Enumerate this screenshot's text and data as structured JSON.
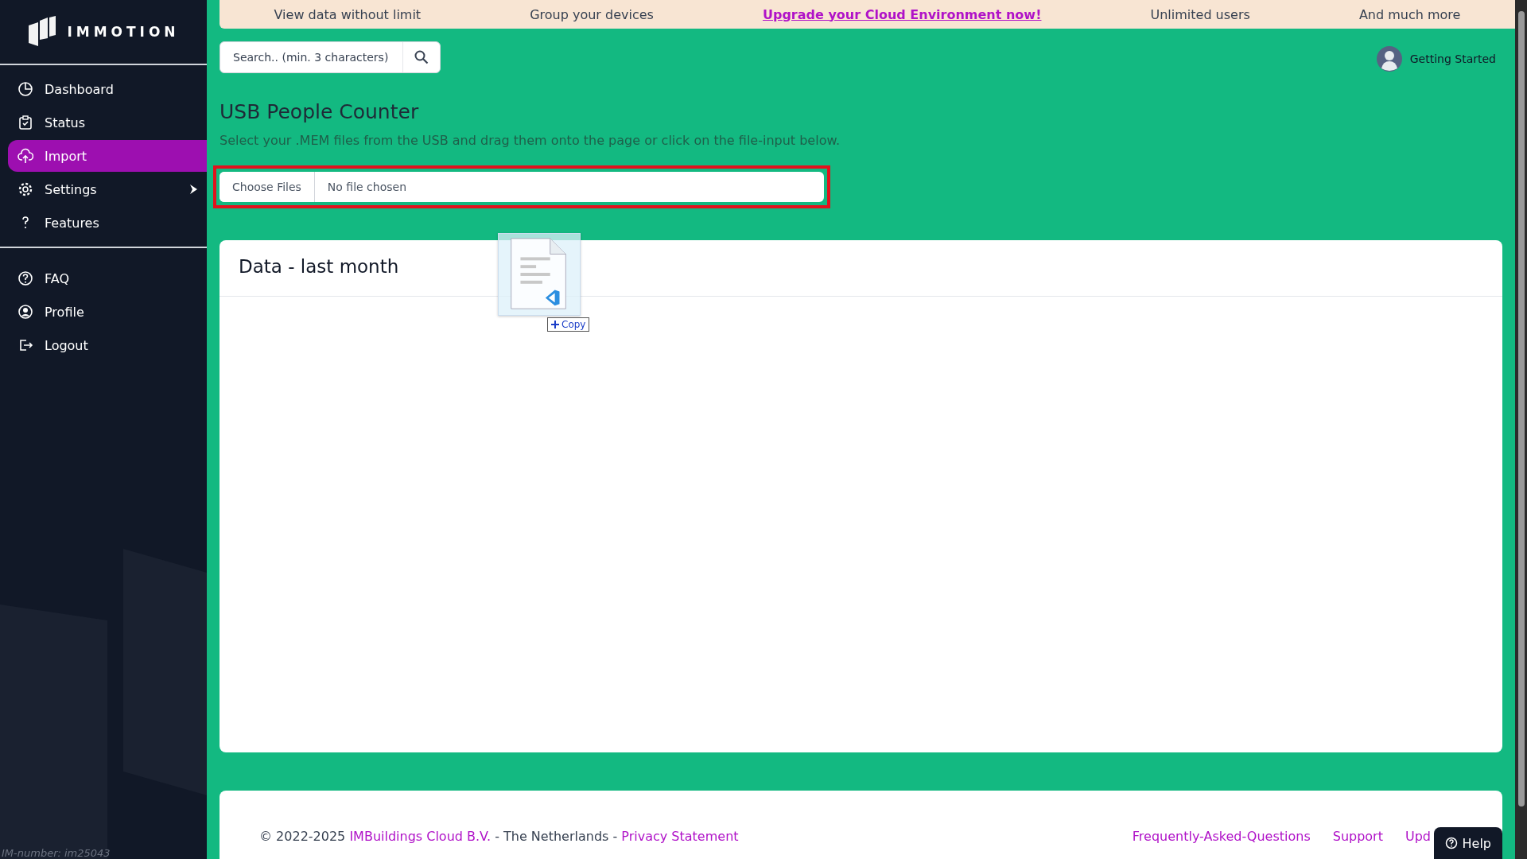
{
  "sidebar": {
    "logo": "IMMOTION",
    "items": [
      {
        "label": "Dashboard",
        "selected": false,
        "submenu": false
      },
      {
        "label": "Status",
        "selected": false,
        "submenu": false
      },
      {
        "label": "Import",
        "selected": true,
        "submenu": false
      },
      {
        "label": "Settings",
        "selected": false,
        "submenu": true
      },
      {
        "label": "Features",
        "selected": false,
        "submenu": false
      }
    ],
    "bottom_items": [
      {
        "label": "FAQ",
        "selected": false,
        "submenu": false
      },
      {
        "label": "Profile",
        "selected": false,
        "submenu": false
      },
      {
        "label": "Logout",
        "selected": false,
        "submenu": false
      }
    ],
    "im_number": "IM-number: im25043"
  },
  "banner": [
    {
      "text": "View data without limit",
      "highlighted": false
    },
    {
      "text": "Group your devices",
      "highlighted": false
    },
    {
      "text": "Upgrade your Cloud Environment now!",
      "highlighted": true
    },
    {
      "text": "Unlimited users",
      "highlighted": false
    },
    {
      "text": "And much more",
      "highlighted": false
    }
  ],
  "search": {
    "placeholder": "Search.. (min. 3 characters)"
  },
  "user_menu": {
    "label": "Getting Started"
  },
  "page": {
    "title": "USB People Counter",
    "description": "Select your .MEM files from the USB and drag them onto the page or click on the file-input below.",
    "file_input": {
      "button": "Choose Files",
      "value": "No file chosen",
      "highlighted": true
    }
  },
  "card": {
    "title": "Data - last month"
  },
  "drag_overlay": {
    "effect": "Copy"
  },
  "footer": {
    "copyright": "© 2022-2025 ",
    "company": "IMBuildings Cloud B.V.",
    "country": " - The Netherlands - ",
    "privacy": "Privacy Statement",
    "links": [
      "Frequently-Asked-Questions",
      "Support",
      "Upd"
    ]
  },
  "help_button": {
    "label": "Help"
  }
}
